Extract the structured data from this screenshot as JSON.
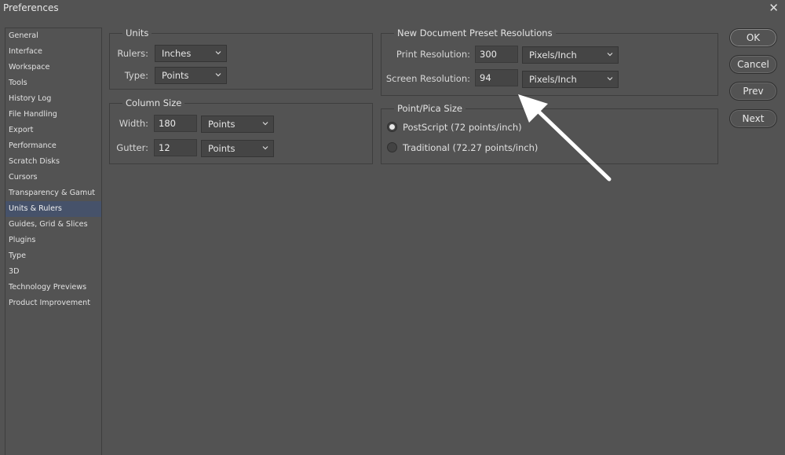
{
  "window": {
    "title": "Preferences",
    "close_glyph": "✕"
  },
  "sidebar": {
    "items": [
      {
        "label": "General"
      },
      {
        "label": "Interface"
      },
      {
        "label": "Workspace"
      },
      {
        "label": "Tools"
      },
      {
        "label": "History Log"
      },
      {
        "label": "File Handling"
      },
      {
        "label": "Export"
      },
      {
        "label": "Performance"
      },
      {
        "label": "Scratch Disks"
      },
      {
        "label": "Cursors"
      },
      {
        "label": "Transparency & Gamut"
      },
      {
        "label": "Units & Rulers"
      },
      {
        "label": "Guides, Grid & Slices"
      },
      {
        "label": "Plugins"
      },
      {
        "label": "Type"
      },
      {
        "label": "3D"
      },
      {
        "label": "Technology Previews"
      },
      {
        "label": "Product Improvement"
      }
    ],
    "active_index": 11
  },
  "units": {
    "title": "Units",
    "rulers_label": "Rulers:",
    "rulers_value": "Inches",
    "type_label": "Type:",
    "type_value": "Points"
  },
  "column_size": {
    "title": "Column Size",
    "width_label": "Width:",
    "width_value": "180",
    "width_unit": "Points",
    "gutter_label": "Gutter:",
    "gutter_value": "12",
    "gutter_unit": "Points"
  },
  "preset_resolutions": {
    "title": "New Document Preset Resolutions",
    "print_label": "Print Resolution:",
    "print_value": "300",
    "print_unit": "Pixels/Inch",
    "screen_label": "Screen Resolution:",
    "screen_value": "94",
    "screen_unit": "Pixels/Inch"
  },
  "point_pica": {
    "title": "Point/Pica Size",
    "options": [
      {
        "label": "PostScript (72 points/inch)",
        "checked": true
      },
      {
        "label": "Traditional (72.27 points/inch)",
        "checked": false
      }
    ]
  },
  "buttons": {
    "ok": "OK",
    "cancel": "Cancel",
    "prev": "Prev",
    "next": "Next"
  },
  "colors": {
    "background": "#535353",
    "active_item": "#46526a",
    "annotation_arrow": "#ffffff"
  }
}
